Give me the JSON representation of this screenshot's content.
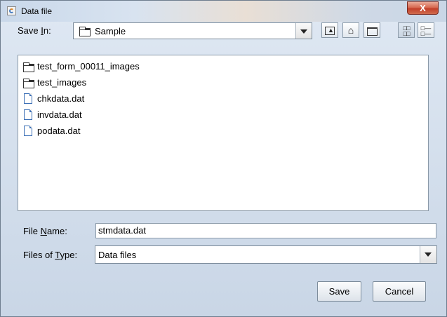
{
  "window": {
    "title": "Data file",
    "close_glyph": "X"
  },
  "save_in": {
    "label_pre": "Save ",
    "label_key": "I",
    "label_post": "n:",
    "value": "Sample"
  },
  "toolbar": {
    "up_icon": "up-folder-icon",
    "home_icon": "home-icon",
    "new_folder_icon": "new-folder-icon",
    "list_icon": "list-view-icon",
    "details_icon": "details-view-icon"
  },
  "files": [
    {
      "name": "test_form_00011_images",
      "type": "folder"
    },
    {
      "name": "test_images",
      "type": "folder"
    },
    {
      "name": "chkdata.dat",
      "type": "file"
    },
    {
      "name": "invdata.dat",
      "type": "file"
    },
    {
      "name": "podata.dat",
      "type": "file"
    }
  ],
  "file_name": {
    "label_pre": "File ",
    "label_key": "N",
    "label_post": "ame:",
    "value": "stmdata.dat"
  },
  "file_type": {
    "label_pre": "Files of ",
    "label_key": "T",
    "label_post": "ype:",
    "value": "Data files"
  },
  "buttons": {
    "save": "Save",
    "cancel": "Cancel"
  }
}
